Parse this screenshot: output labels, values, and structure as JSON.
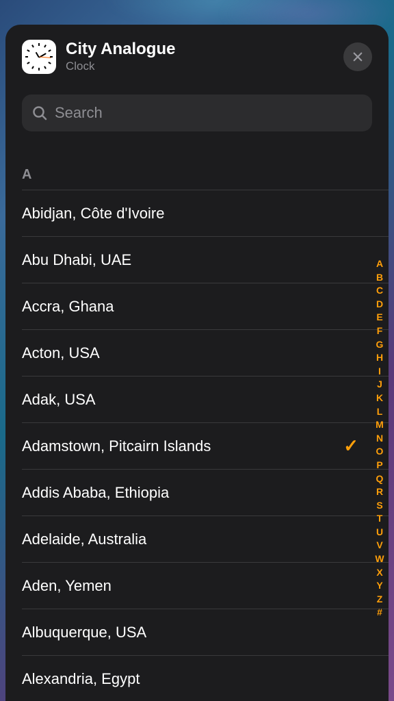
{
  "header": {
    "title": "City Analogue",
    "subtitle": "Clock"
  },
  "search": {
    "placeholder": "Search",
    "value": ""
  },
  "section_letter": "A",
  "cities": [
    {
      "name": "Abidjan, Côte d'Ivoire",
      "selected": false
    },
    {
      "name": "Abu Dhabi, UAE",
      "selected": false
    },
    {
      "name": "Accra, Ghana",
      "selected": false
    },
    {
      "name": "Acton, USA",
      "selected": false
    },
    {
      "name": "Adak, USA",
      "selected": false
    },
    {
      "name": "Adamstown, Pitcairn Islands",
      "selected": true
    },
    {
      "name": "Addis Ababa, Ethiopia",
      "selected": false
    },
    {
      "name": "Adelaide, Australia",
      "selected": false
    },
    {
      "name": "Aden, Yemen",
      "selected": false
    },
    {
      "name": "Albuquerque, USA",
      "selected": false
    },
    {
      "name": "Alexandria, Egypt",
      "selected": false
    }
  ],
  "index": [
    "A",
    "B",
    "C",
    "D",
    "E",
    "F",
    "G",
    "H",
    "I",
    "J",
    "K",
    "L",
    "M",
    "N",
    "O",
    "P",
    "Q",
    "R",
    "S",
    "T",
    "U",
    "V",
    "W",
    "X",
    "Y",
    "Z",
    "#"
  ],
  "colors": {
    "accent": "#ff9f0a"
  }
}
